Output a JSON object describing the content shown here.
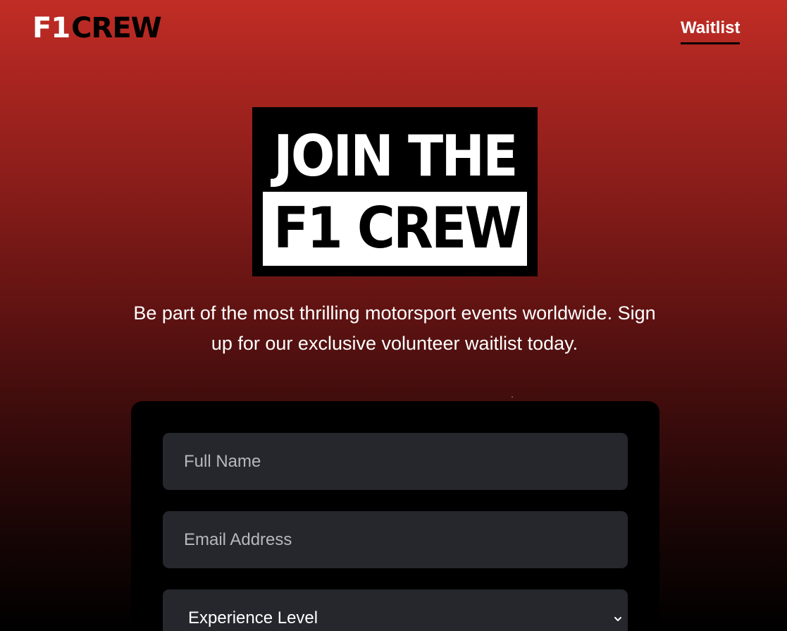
{
  "header": {
    "logo": {
      "part1": "F1",
      "part2": "CREW"
    },
    "nav_link": "Waitlist"
  },
  "hero": {
    "line1": "JOIN THE",
    "line2": "F1 CREW",
    "subtitle": "Be part of the most thrilling motorsport events worldwide. Sign up for our exclusive volunteer waitlist today."
  },
  "form": {
    "full_name_placeholder": "Full Name",
    "email_placeholder": "Email Address",
    "experience_select": "Experience Level",
    "experience_icon": "chevron-down-icon"
  },
  "colors": {
    "background_top": "#c12d25",
    "background_bottom": "#000000",
    "card": "#000000",
    "field": "#25272d",
    "text": "#ffffff"
  }
}
